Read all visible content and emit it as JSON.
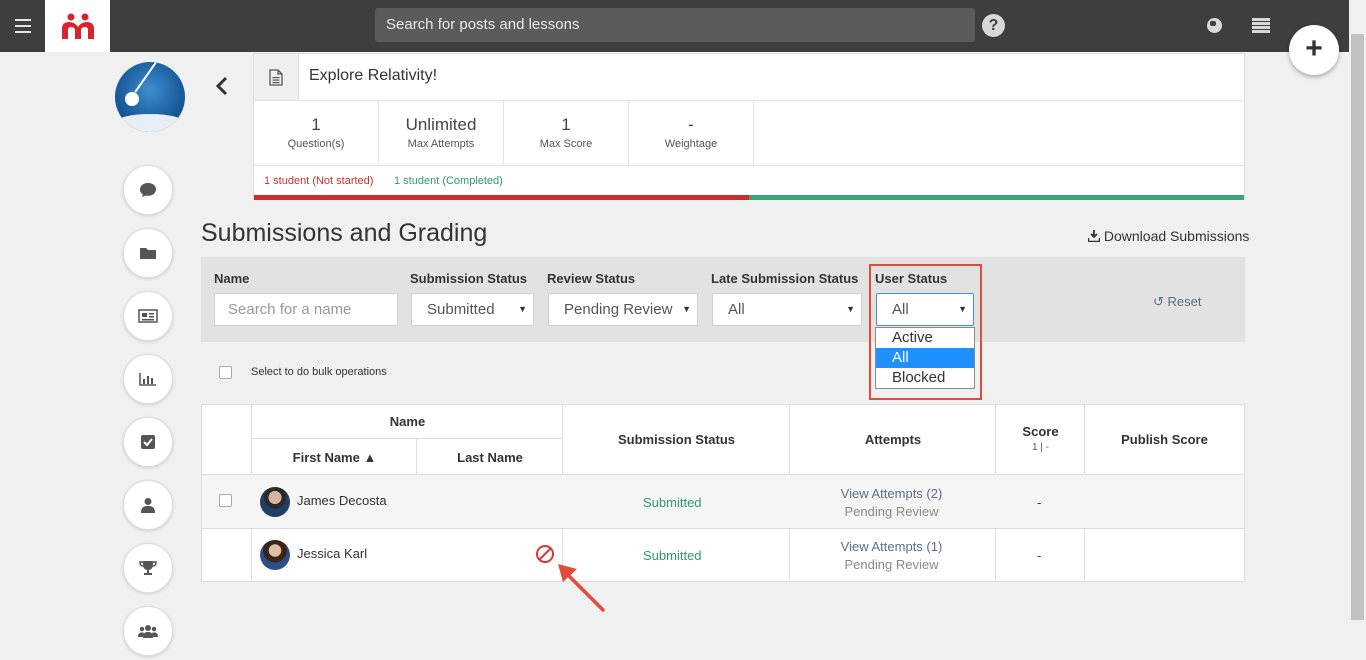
{
  "topbar": {
    "search_placeholder": "Search for posts and lessons",
    "help_icon": "question-circle-icon",
    "fab_label": "+"
  },
  "assignment": {
    "title": "Explore Relativity!",
    "stats": [
      {
        "value": "1",
        "label": "Question(s)"
      },
      {
        "value": "Unlimited",
        "label": "Max Attempts"
      },
      {
        "value": "1",
        "label": "Max Score"
      },
      {
        "value": "-",
        "label": "Weightage"
      }
    ],
    "progress": {
      "not_started": "1 student (Not started)",
      "completed": "1 student (Completed)",
      "completed_fraction": 0.5
    }
  },
  "section": {
    "title": "Submissions and Grading",
    "download_label": "Download Submissions"
  },
  "filters": {
    "name_label": "Name",
    "name_placeholder": "Search for a name",
    "submission_status_label": "Submission Status",
    "submission_status_value": "Submitted",
    "review_status_label": "Review Status",
    "review_status_value": "Pending Review",
    "late_status_label": "Late Submission Status",
    "late_status_value": "All",
    "user_status_label": "User Status",
    "user_status_value": "All",
    "user_status_options": [
      "Active",
      "All",
      "Blocked"
    ],
    "reset_label": "Reset"
  },
  "bulk": {
    "label": "Select to do bulk operations"
  },
  "table": {
    "headers": {
      "name": "Name",
      "first_name": "First Name ▲",
      "last_name": "Last Name",
      "submission_status": "Submission Status",
      "attempts": "Attempts",
      "score": "Score",
      "score_sub": "1 | -",
      "publish_score": "Publish Score"
    },
    "rows": [
      {
        "name": "James Decosta",
        "status": "Submitted",
        "attempts": "View Attempts (2)",
        "review": "Pending Review",
        "score": "-",
        "blocked": false
      },
      {
        "name": "Jessica Karl",
        "status": "Submitted",
        "attempts": "View Attempts (1)",
        "review": "Pending Review",
        "score": "-",
        "blocked": true
      }
    ]
  },
  "colors": {
    "topbar": "#3e3e3e",
    "not_started": "#c9302c",
    "completed": "#3aa57b",
    "selected_option": "#1e90ff",
    "highlight": "#e04b3c"
  }
}
